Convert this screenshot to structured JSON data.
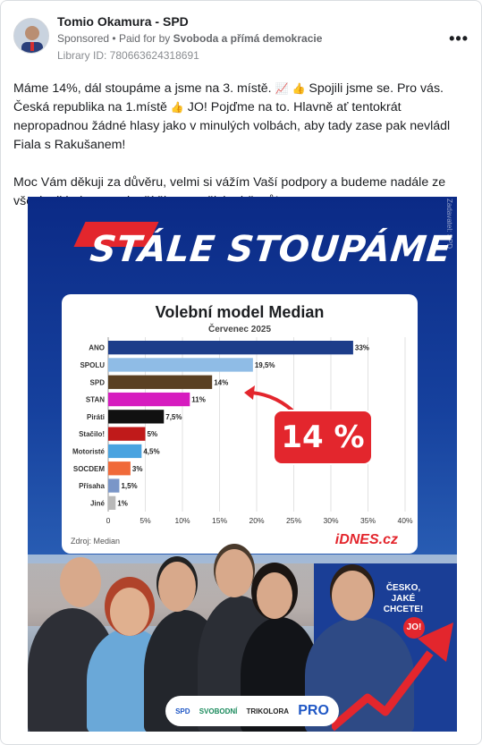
{
  "post": {
    "author": "Tomio Okamura - SPD",
    "sponsored": "Sponsored",
    "paid_prefix": "Paid for by",
    "paid_by": "Svoboda a přímá demokracie",
    "library_id": "Library ID: 780663624318691",
    "more": "•••",
    "paragraph1_a": "Máme 14%, dál stoupáme a jsme na 3. místě.",
    "paragraph1_b": "Spojili jsme se. Pro vás. Česká republika na 1.místě",
    "paragraph1_c": "JO! Pojďme na to. Hlavně ať tentokrát nepropadnou žádné hlasy jako v minulých volbách, aby tady zase pak nevládl Fiala s Rakušanem!",
    "paragraph2": "Moc Vám děkuji za důvěru, velmi si vážím Vaší podpory a budeme nadále ze všech sil bojovat za lepší životy našich občanů!"
  },
  "creative": {
    "headline": "STÁLE STOUPÁME",
    "side_credit": "Zadavatel: SPD",
    "badge": "14 %",
    "poster_text": "ČESKO, JAKÉ CHCETE!",
    "poster_jo": "JO!",
    "logos": [
      "SPD",
      "SVOBODNÍ",
      "TRIKOLORA",
      "PRO"
    ]
  },
  "chart_data": {
    "type": "bar",
    "orientation": "horizontal",
    "title": "Volební model Median",
    "subtitle": "Červenec 2025",
    "source": "Zdroj: Median",
    "brand": "iDNES.cz",
    "categories": [
      "ANO",
      "SPOLU",
      "SPD",
      "STAN",
      "Piráti",
      "Stačilo!",
      "Motoristé",
      "SOCDEM",
      "Přísaha",
      "Jiné"
    ],
    "values": [
      33,
      19.5,
      14,
      11,
      7.5,
      5,
      4.5,
      3,
      1.5,
      1
    ],
    "value_labels": [
      "33%",
      "19,5%",
      "14%",
      "11%",
      "7,5%",
      "5%",
      "4,5%",
      "3%",
      "1,5%",
      "1%"
    ],
    "colors": [
      "#1d3d8a",
      "#8fbce6",
      "#5a4023",
      "#d61cbf",
      "#111111",
      "#c01a1a",
      "#4aa3e0",
      "#f06a3a",
      "#7a96c8",
      "#b9b9b9"
    ],
    "xlim": [
      0,
      40
    ],
    "xticks": [
      "0",
      "5%",
      "10%",
      "15%",
      "20%",
      "25%",
      "30%",
      "35%",
      "40%"
    ],
    "grid": true
  }
}
